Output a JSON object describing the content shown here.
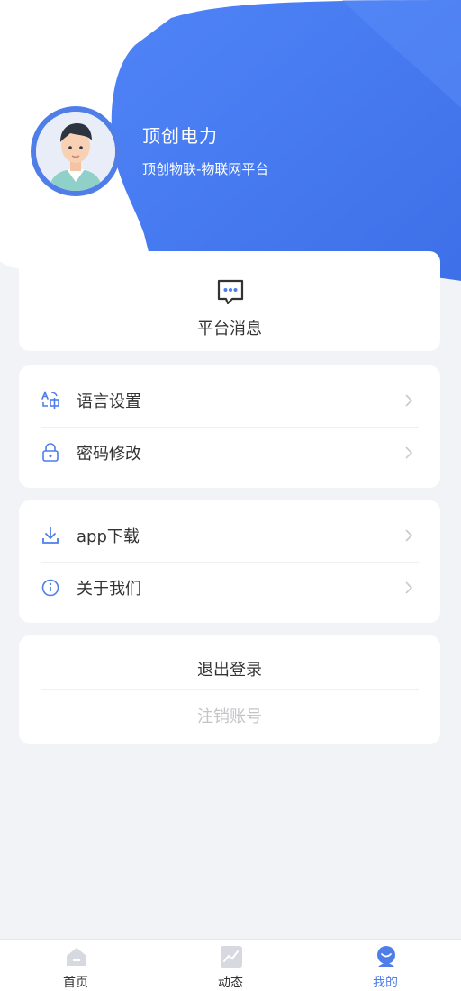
{
  "profile": {
    "name": "顶创电力",
    "subtitle": "顶创物联-物联网平台"
  },
  "messages": {
    "label": "平台消息"
  },
  "settings": [
    {
      "label": "语言设置",
      "icon": "translate-icon"
    },
    {
      "label": "密码修改",
      "icon": "lock-icon"
    }
  ],
  "info": [
    {
      "label": "app下载",
      "icon": "download-icon"
    },
    {
      "label": "关于我们",
      "icon": "info-icon"
    }
  ],
  "account": {
    "logout_label": "退出登录",
    "deregister_label": "注销账号"
  },
  "tabbar": {
    "items": [
      {
        "label": "首页",
        "icon": "home-icon"
      },
      {
        "label": "动态",
        "icon": "chart-icon"
      },
      {
        "label": "我的",
        "icon": "profile-icon"
      }
    ],
    "active_index": 2
  },
  "colors": {
    "accent": "#4f7ee9",
    "background": "#f2f3f7"
  }
}
